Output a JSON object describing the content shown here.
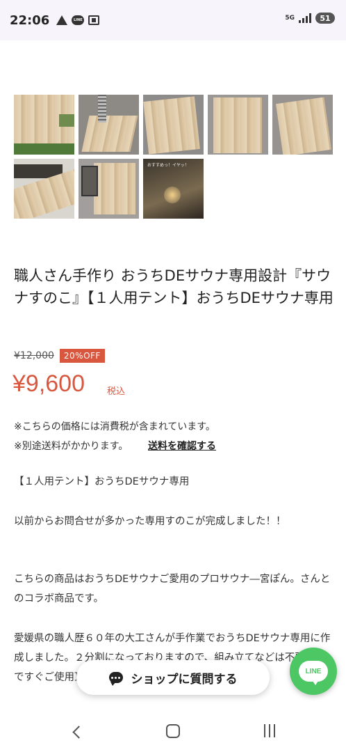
{
  "status_bar": {
    "time": "22:06",
    "line_icon_text": "LINE",
    "network": "5G",
    "battery": "51"
  },
  "gallery": {
    "thumb_8_caption": "おすすめっ！イヤッ！"
  },
  "product": {
    "title": "職人さん手作り おうちDEサウナ専用設計『サウナすのこ』【１人用テント】おうちDEサウナ専用",
    "original_price": "¥12,000",
    "discount_badge": "20%OFF",
    "sale_price": "¥9,600",
    "tax_label": "税込",
    "tax_note": "※こちらの価格には消費税が含まれています。",
    "shipping_note": "※別途送料がかかります。",
    "shipping_link": "送料を確認する"
  },
  "description": {
    "p1": "【１人用テント】おうちDEサウナ専用",
    "p2": "以前からお問合せが多かった専用すのこが完成しました！！",
    "p3": "こちらの商品はおうちDEサウナご愛用のプロサウナ―宮ぽん。さんとのコラボ商品です。",
    "p4": "愛媛県の職人歴６０年の大工さんが手作業でおうちDEサウナ専用に作成しました。２分割になっておりますので、組み立てなどは不要なのですぐご使用頂けます。"
  },
  "floating": {
    "ask_shop_label": "ショップに質問する",
    "line_label": "LINE"
  },
  "colors": {
    "accent": "#d9573f",
    "line_green": "#4cc764"
  }
}
